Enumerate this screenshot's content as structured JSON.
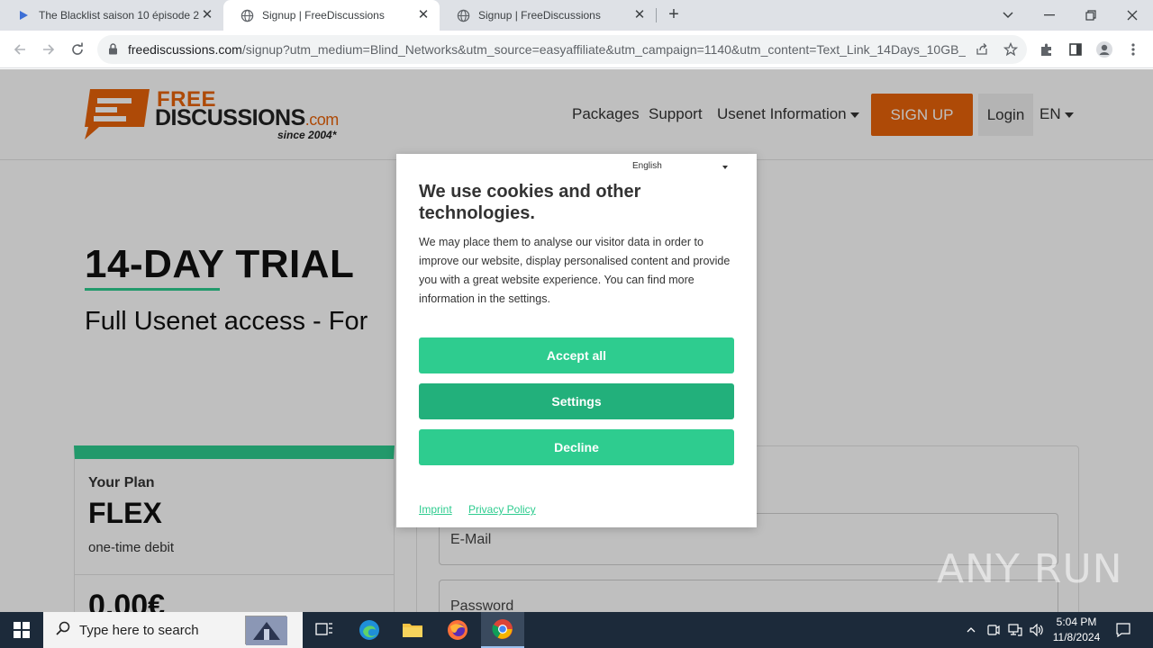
{
  "browser": {
    "tabs": [
      {
        "title": "The Blacklist saison 10 épisode 2",
        "active": false
      },
      {
        "title": "Signup | FreeDiscussions",
        "active": true
      },
      {
        "title": "Signup | FreeDiscussions",
        "active": false
      }
    ],
    "url_domain": "freediscussions.com",
    "url_path": "/signup?utm_medium=Blind_Networks&utm_source=easyaffiliate&utm_campaign=1140&utm_content=Text_Link_14Days_10GB_..."
  },
  "site": {
    "logo_free": "FREE",
    "logo_discussions": "DISCUSSIONS",
    "logo_com": ".com",
    "logo_since": "since 2004*",
    "nav": {
      "packages": "Packages",
      "support": "Support",
      "usenet_info": "Usenet Information",
      "signup": "SIGN UP",
      "login": "Login",
      "language": "EN"
    },
    "hero_title": "14-DAY TRIAL",
    "hero_subtitle": "Full Usenet access - For",
    "plan": {
      "label": "Your Plan",
      "name": "FLEX",
      "billing": "one-time debit",
      "price": "0,00€"
    },
    "form": {
      "email_placeholder": "E-Mail",
      "password_placeholder": "Password"
    }
  },
  "cookie_modal": {
    "language": "English",
    "title": "We use cookies and other technologies.",
    "body": "We may place them to analyse our visitor data in order to improve our website, display personalised content and provide you with a great website experience. You can find more information in the settings.",
    "accept_label": "Accept all",
    "settings_label": "Settings",
    "decline_label": "Decline",
    "imprint_label": "Imprint",
    "privacy_label": "Privacy Policy"
  },
  "watermark": "ANY RUN",
  "taskbar": {
    "search_placeholder": "Type here to search",
    "time": "5:04 PM",
    "date": "11/8/2024"
  },
  "colors": {
    "brand_orange": "#e8630a",
    "cookie_green": "#2ecc8f",
    "cookie_green_dark": "#22b07b"
  }
}
